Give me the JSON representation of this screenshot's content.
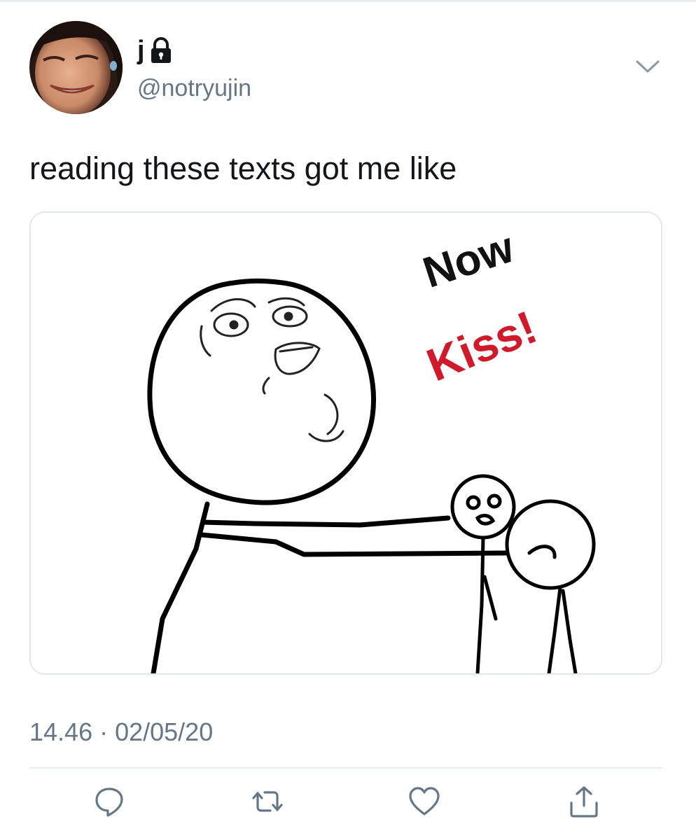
{
  "tweet": {
    "author": {
      "display_name": "j",
      "handle": "@notryujin",
      "protected_icon": "lock-icon",
      "avatar_icon": "avatar-photo"
    },
    "menu_icon": "chevron-down-icon",
    "text": "reading these texts got me like",
    "media": {
      "caption_line1": "Now",
      "caption_line2": "Kiss!",
      "caption_color_line1": "#111111",
      "caption_color_line2": "#d0192a"
    },
    "timestamp": "14.46 · 02/05/20",
    "actions": [
      {
        "name": "reply",
        "icon": "reply-icon"
      },
      {
        "name": "retweet",
        "icon": "retweet-icon"
      },
      {
        "name": "like",
        "icon": "heart-icon"
      },
      {
        "name": "share",
        "icon": "share-icon"
      }
    ]
  },
  "colors": {
    "text_primary": "#14171a",
    "text_secondary": "#657786",
    "border": "#e1e8ed",
    "icon": "#657786"
  }
}
